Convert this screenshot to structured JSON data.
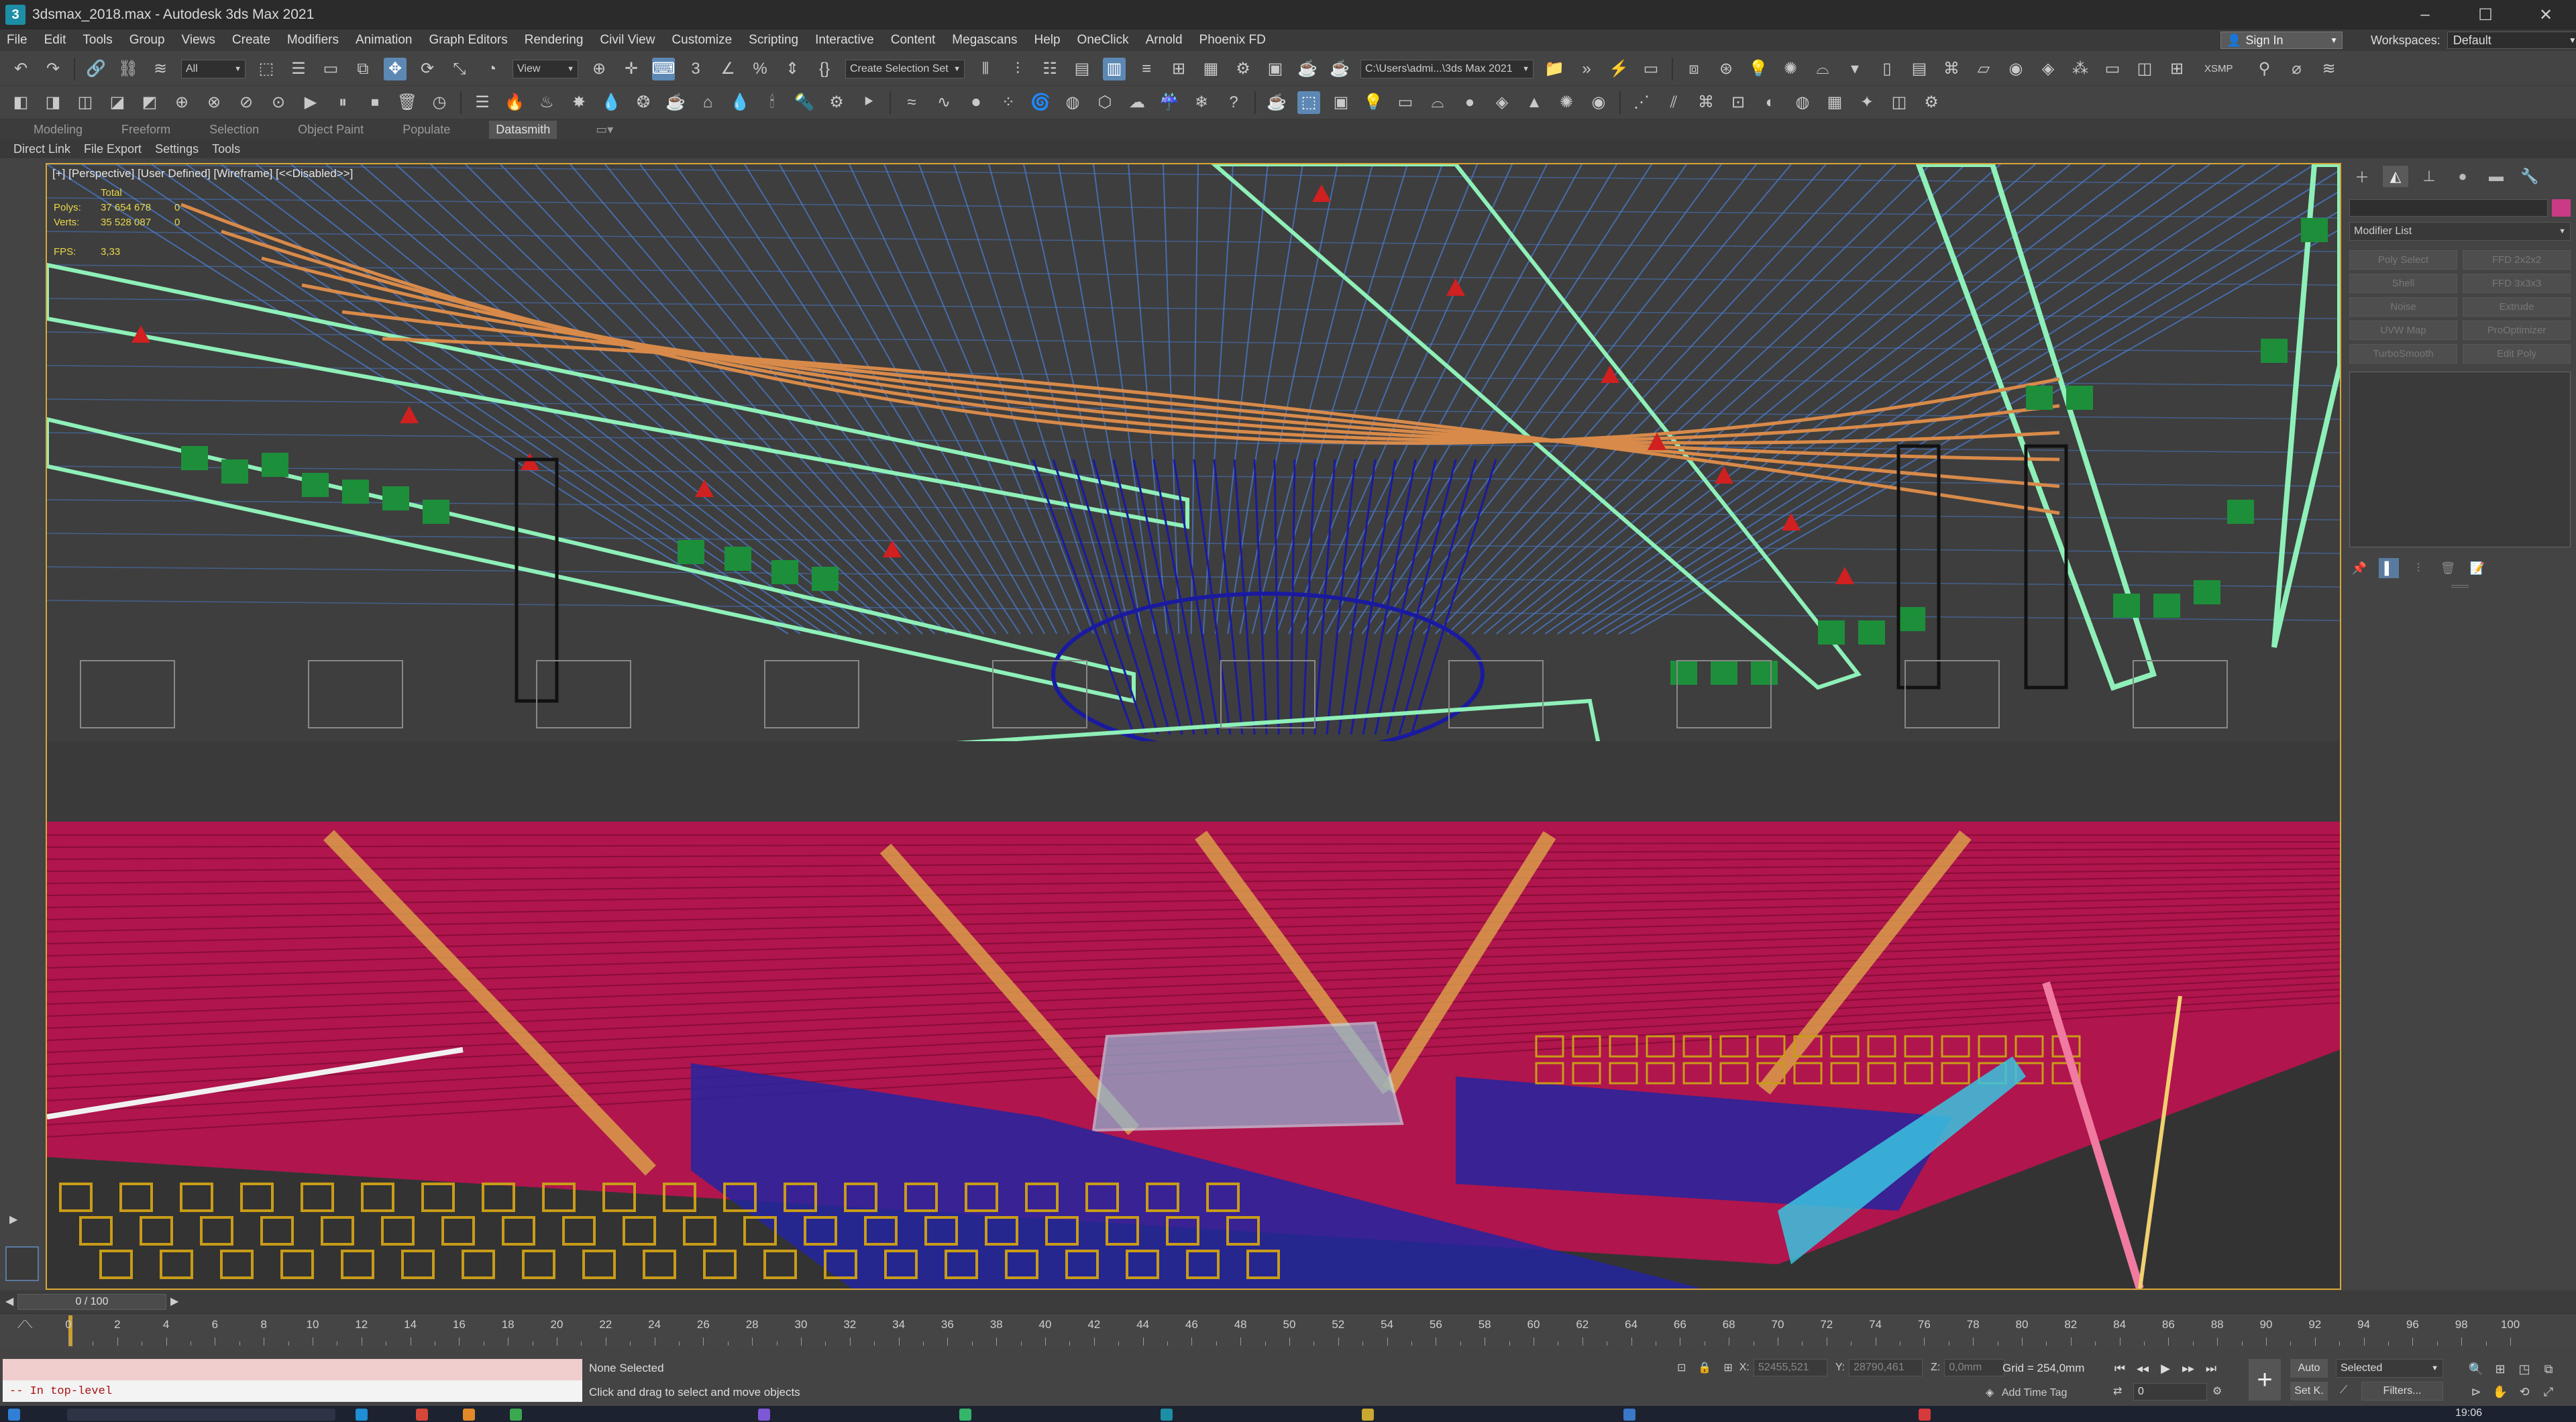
{
  "window": {
    "title": "3dsmax_2018.max - Autodesk 3ds Max 2021",
    "minimize": "–",
    "maximize": "☐",
    "close": "✕"
  },
  "menu": [
    "File",
    "Edit",
    "Tools",
    "Group",
    "Views",
    "Create",
    "Modifiers",
    "Animation",
    "Graph Editors",
    "Rendering",
    "Civil View",
    "Customize",
    "Scripting",
    "Interactive",
    "Content",
    "Megascans",
    "Help",
    "OneClick",
    "Arnold",
    "Phoenix FD"
  ],
  "signin": {
    "label": "Sign In"
  },
  "workspaces": {
    "label": "Workspaces:",
    "value": "Default"
  },
  "toolbar": {
    "filter_value": "All",
    "refcoord_value": "View",
    "selection_set_placeholder": "Create Selection Set",
    "project_path": "C:\\Users\\admi...\\3ds Max 2021",
    "xsmp": "XSMP"
  },
  "ribbon_tabs": [
    {
      "label": "Modeling",
      "active": false
    },
    {
      "label": "Freeform",
      "active": false
    },
    {
      "label": "Selection",
      "active": false
    },
    {
      "label": "Object Paint",
      "active": false
    },
    {
      "label": "Populate",
      "active": false
    },
    {
      "label": "Datasmith",
      "active": true
    }
  ],
  "sub_tabs": [
    "Direct Link",
    "File Export",
    "Settings",
    "Tools"
  ],
  "viewport": {
    "label": "[+] [Perspective] [User Defined] [Wireframe] [<<Disabled>>]",
    "stats": {
      "header": "Total",
      "polys_label": "Polys:",
      "polys_value": "37 654 678",
      "polys_extra": "0",
      "verts_label": "Verts:",
      "verts_value": "35 528 087",
      "verts_extra": "0",
      "fps_label": "FPS:",
      "fps_value": "3,33"
    },
    "colors": {
      "seats": "#b0154d",
      "lights": "#1d8f3a",
      "truss_mint": "#8ef0b8",
      "truss_blue": "#4a80d8",
      "chairs": "#c89c18",
      "chandelier": "#1a1aa0",
      "cables": "#d88a4a"
    }
  },
  "command_panel": {
    "tabs": [
      "create-icon",
      "modify-icon",
      "hierarchy-icon",
      "motion-icon",
      "display-icon",
      "utilities-icon"
    ],
    "modifier_list": "Modifier List",
    "modifier_buttons": [
      "Poly Select",
      "FFD 2x2x2",
      "Shell",
      "FFD 3x3x3",
      "Noise",
      "Extrude",
      "UVW Map",
      "ProOptimizer",
      "TurboSmooth",
      "Edit Poly"
    ],
    "swatch_color": "#c93b84"
  },
  "time_slider": {
    "frame": "0 / 100",
    "ticks": [
      "0",
      "2",
      "4",
      "6",
      "8",
      "10",
      "12",
      "14",
      "16",
      "18",
      "20",
      "22",
      "24",
      "26",
      "28",
      "30",
      "32",
      "34",
      "36",
      "38",
      "40",
      "42",
      "44",
      "46",
      "48",
      "50",
      "52",
      "54",
      "56",
      "58",
      "60",
      "62",
      "64",
      "66",
      "68",
      "70",
      "72",
      "74",
      "76",
      "78",
      "80",
      "82",
      "84",
      "86",
      "88",
      "90",
      "92",
      "94",
      "96",
      "98",
      "100"
    ]
  },
  "status": {
    "maxscript_output": "-- In top-level",
    "selection": "None Selected",
    "prompt": "Click and drag to select and move objects",
    "x_label": "X:",
    "x_value": "52455,521",
    "y_label": "Y:",
    "y_value": "28790,461",
    "z_label": "Z:",
    "z_value": "0,0mm",
    "grid": "Grid = 254,0mm",
    "add_time_tag": "Add Time Tag",
    "frame_value": "0",
    "auto_key": "Auto",
    "set_key": "Set K.",
    "selected": "Selected",
    "filters": "Filters..."
  },
  "taskbar": {
    "clock": "19:06"
  }
}
